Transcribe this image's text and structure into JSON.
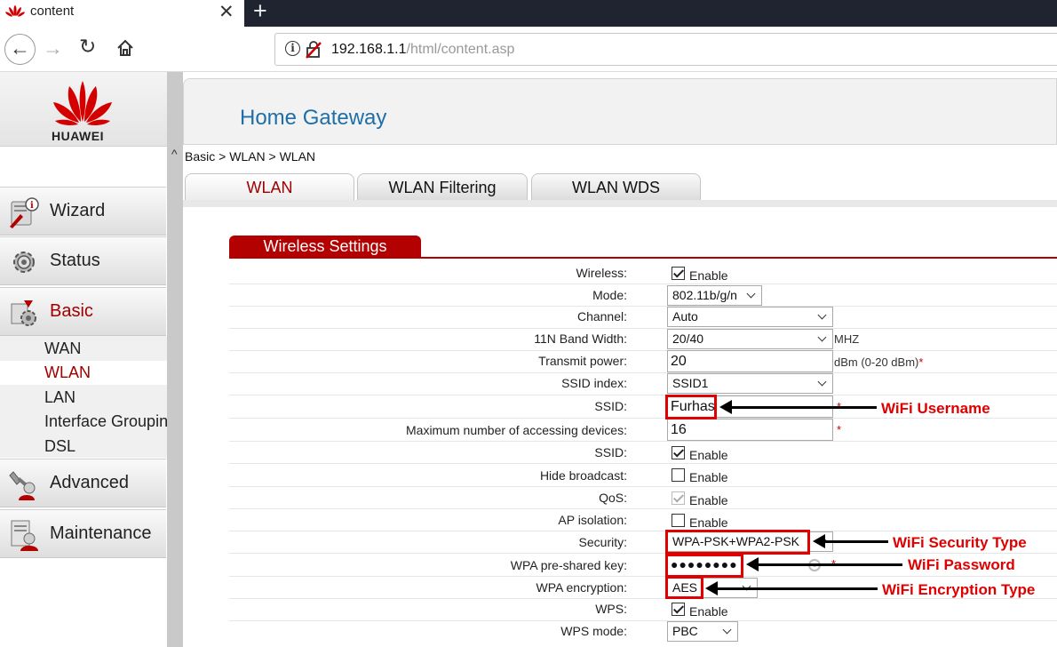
{
  "browser": {
    "tab_title": "content",
    "tab_close": "✕",
    "new_tab": "+",
    "url_host": "192.168.1.1",
    "url_path": "/html/content.asp"
  },
  "brand": {
    "logo_text": "HUAWEI",
    "app_title": "Home Gateway",
    "accent": "#b30000"
  },
  "sidebar": {
    "menu": [
      {
        "label": "Wizard",
        "icon": "wizard-icon"
      },
      {
        "label": "Status",
        "icon": "gear-icon"
      },
      {
        "label": "Basic",
        "icon": "basic-icon"
      },
      {
        "label": "Advanced",
        "icon": "advanced-icon"
      },
      {
        "label": "Maintenance",
        "icon": "maintenance-icon"
      }
    ],
    "submenu": [
      "WAN",
      "WLAN",
      "LAN",
      "Interface Grouping",
      "DSL"
    ],
    "active_submenu": "WLAN"
  },
  "breadcrumb": "Basic > WLAN > WLAN",
  "tabs": [
    "WLAN",
    "WLAN Filtering",
    "WLAN WDS"
  ],
  "active_tab": "WLAN",
  "section_title": "Wireless Settings",
  "form": {
    "wireless": {
      "label": "Wireless:",
      "checked": true,
      "option": "Enable"
    },
    "mode": {
      "label": "Mode:",
      "value": "802.11b/g/n"
    },
    "channel": {
      "label": "Channel:",
      "value": "Auto"
    },
    "band_width": {
      "label": "11N Band Width:",
      "value": "20/40",
      "unit": "MHZ"
    },
    "transmit_power": {
      "label": "Transmit power:",
      "value": "20",
      "unit": "dBm (0-20 dBm)",
      "required": "*"
    },
    "ssid_index": {
      "label": "SSID index:",
      "value": "SSID1"
    },
    "ssid_name": {
      "label": "SSID:",
      "value": "Furhas",
      "required": "*"
    },
    "max_devices": {
      "label": "Maximum number of accessing devices:",
      "value": "16",
      "required": "*"
    },
    "ssid_enable": {
      "label": "SSID:",
      "checked": true,
      "option": "Enable"
    },
    "hide_broadcast": {
      "label": "Hide broadcast:",
      "checked": false,
      "option": "Enable"
    },
    "qos": {
      "label": "QoS:",
      "checked": true,
      "option": "Enable"
    },
    "ap_isolation": {
      "label": "AP isolation:",
      "checked": false,
      "option": "Enable"
    },
    "security": {
      "label": "Security:",
      "value": "WPA-PSK+WPA2-PSK"
    },
    "wpa_key": {
      "label": "WPA pre-shared key:",
      "value": "●●●●●●●●",
      "required": "*"
    },
    "wpa_encryption": {
      "label": "WPA encryption:",
      "value": "AES"
    },
    "wps": {
      "label": "WPS:",
      "checked": true,
      "option": "Enable"
    },
    "wps_mode": {
      "label": "WPS mode:",
      "value": "PBC"
    }
  },
  "annotations": {
    "username": "WiFi Username",
    "security_type": "WiFi Security Type",
    "password": "WiFi Password",
    "encryption_type": "WiFi Encryption Type"
  }
}
